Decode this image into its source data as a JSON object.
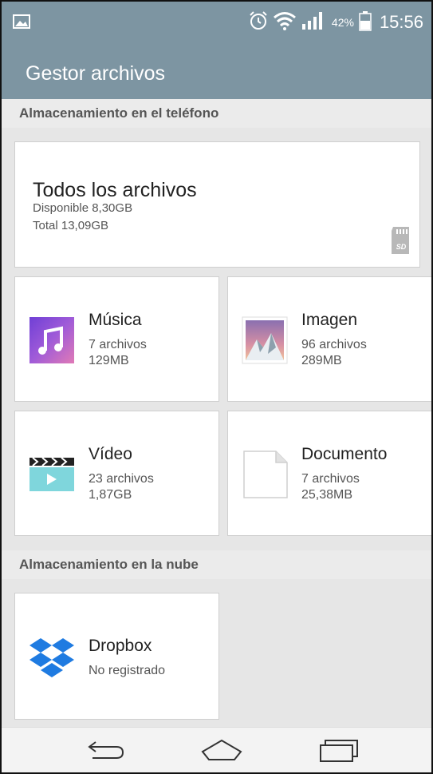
{
  "status_bar": {
    "battery_percent": "42%",
    "time": "15:56",
    "icons": [
      "image-notification-icon",
      "alarm-icon",
      "wifi-icon",
      "signal-icon",
      "battery-icon"
    ]
  },
  "app": {
    "title": "Gestor archivos"
  },
  "phone_storage": {
    "header": "Almacenamiento en el teléfono",
    "all_files": {
      "title": "Todos los archivos",
      "available": "Disponible 8,30GB",
      "total": "Total 13,09GB",
      "icon": "sd-card-icon"
    },
    "categories": [
      {
        "title": "Música",
        "count": "7 archivos",
        "size": "129MB",
        "icon": "music-icon"
      },
      {
        "title": "Imagen",
        "count": "96 archivos",
        "size": "289MB",
        "icon": "image-icon"
      },
      {
        "title": "Vídeo",
        "count": "23 archivos",
        "size": "1,87GB",
        "icon": "video-icon"
      },
      {
        "title": "Documento",
        "count": "7 archivos",
        "size": "25,38MB",
        "icon": "document-icon"
      }
    ]
  },
  "cloud_storage": {
    "header": "Almacenamiento en la nube",
    "services": [
      {
        "title": "Dropbox",
        "status": "No registrado",
        "icon": "dropbox-icon"
      }
    ]
  },
  "nav": {
    "back": "back-icon",
    "home": "home-icon",
    "recent": "recent-apps-icon"
  },
  "colors": {
    "header_bar": "#7d95a2",
    "background": "#e6e6e6",
    "card": "#ffffff",
    "dropbox_blue": "#1f7be1",
    "video_teal": "#7fd6dc"
  }
}
